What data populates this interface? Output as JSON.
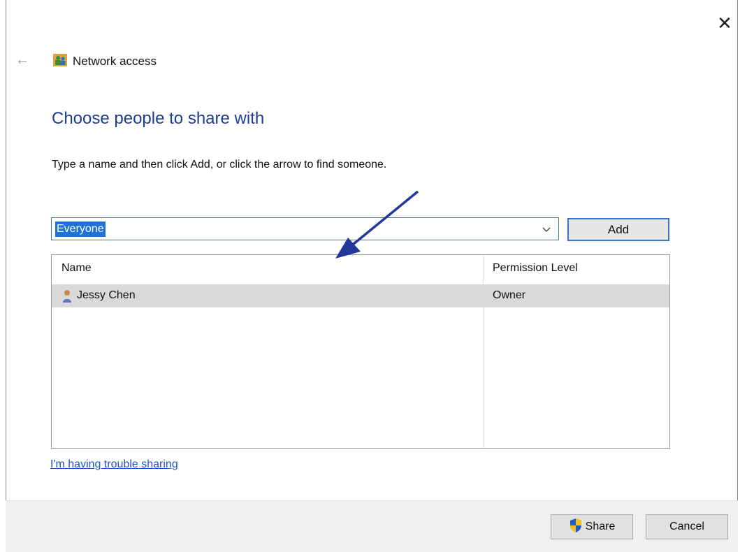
{
  "window": {
    "title": "Network access",
    "close_glyph": "✕",
    "back_glyph": "←"
  },
  "main": {
    "heading": "Choose people to share with",
    "instructions": "Type a name and then click Add, or click the arrow to find someone.",
    "combo_value": "Everyone",
    "add_label": "Add"
  },
  "list": {
    "columns": [
      "Name",
      "Permission Level"
    ],
    "rows": [
      {
        "name": "Jessy Chen",
        "permission": "Owner",
        "icon": "user-icon"
      }
    ]
  },
  "trouble_link": "I'm having trouble sharing",
  "footer": {
    "share_label": "Share",
    "cancel_label": "Cancel"
  },
  "colors": {
    "heading": "#1e3d8f",
    "link": "#1a56c4",
    "selection": "#1f73d6",
    "row_highlight": "#d9d9d9",
    "annotation_arrow": "#22389a"
  },
  "icons": {
    "title": "network-people-icon",
    "back": "back-arrow-icon",
    "close": "close-icon",
    "dropdown": "chevron-down-icon",
    "share": "uac-shield-icon"
  }
}
